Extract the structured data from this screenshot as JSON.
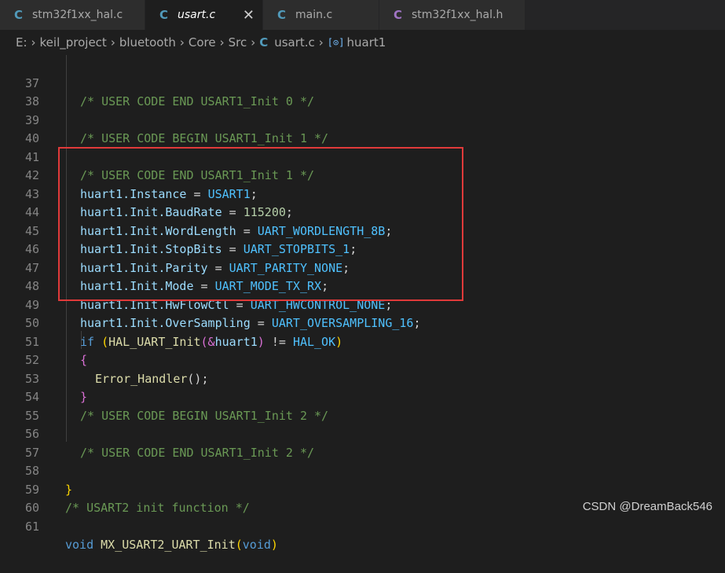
{
  "tabs": [
    {
      "icon": "C",
      "title": "stm32f1xx_hal.c"
    },
    {
      "icon": "C",
      "title": "usart.c",
      "close": "✕"
    },
    {
      "icon": "C",
      "title": "main.c"
    },
    {
      "icon": "C",
      "title": "stm32f1xx_hal.h"
    }
  ],
  "breadcrumb": {
    "items": [
      "E:",
      "keil_project",
      "bluetooth",
      "Core",
      "Src"
    ],
    "file_icon": "C",
    "file": "usart.c",
    "symbol_icon": "[⊙]",
    "symbol": "huart1",
    "separator": "›"
  },
  "code": {
    "l37": "37",
    "l38": "38",
    "l39": "39",
    "l40": "40",
    "l41": "41",
    "l42": "42",
    "l43": "43",
    "l44": "44",
    "l45": "45",
    "l46": "46",
    "l47": "47",
    "l48": "48",
    "l49": "49",
    "l50": "50",
    "l51": "51",
    "l52": "52",
    "l53": "53",
    "l54": "54",
    "l55": "55",
    "l56": "56",
    "l57": "57",
    "l58": "58",
    "l59": "59",
    "l60": "60",
    "l61": "61",
    "c37": "/* USER CODE END USART1_Init 0 */",
    "c39": "/* USER CODE BEGIN USART1_Init 1 */",
    "c41": "/* USER CODE END USART1_Init 1 */",
    "s42a": "huart1.Instance",
    "s42b": " = ",
    "s42c": "USART1",
    "s42d": ";",
    "s43a": "huart1.Init.BaudRate",
    "s43b": " = ",
    "s43c": "115200",
    "s43d": ";",
    "s44a": "huart1.Init.WordLength",
    "s44b": " = ",
    "s44c": "UART_WORDLENGTH_8B",
    "s44d": ";",
    "s45a": "huart1.Init.StopBits",
    "s45b": " = ",
    "s45c": "UART_STOPBITS_1",
    "s45d": ";",
    "s46a": "huart1.Init.Parity",
    "s46b": " = ",
    "s46c": "UART_PARITY_NONE",
    "s46d": ";",
    "s47a": "huart1.Init.Mode",
    "s47b": " = ",
    "s47c": "UART_MODE_TX_RX",
    "s47d": ";",
    "s48a": "huart1.Init.HwFlowCtl",
    "s48b": " = ",
    "s48c": "UART_HWCONTROL_NONE",
    "s48d": ";",
    "s49a": "huart1.Init.OverSampling",
    "s49b": " = ",
    "s49c": "UART_OVERSAMPLING_16",
    "s49d": ";",
    "s50a": "if",
    "s50b": " (",
    "s50c": "HAL_UART_Init",
    "s50d": "(&",
    "s50e": "huart1",
    "s50f": ")",
    " s50g": "",
    "s50h": " != ",
    "s50i": "HAL_OK",
    "s50j": ")",
    "s51": "{",
    "s52a": "Error_Handler",
    "s52b": "();",
    "s53": "}",
    "c54": "/* USER CODE BEGIN USART1_Init 2 */",
    "c56": "/* USER CODE END USART1_Init 2 */",
    "s58": "}",
    "c59": "/* USART2 init function */",
    "s61a": "void",
    "s61b": " ",
    "s61c": "MX_USART2_UART_Init",
    "s61d": "(",
    "s61e": "void",
    "s61f": ")"
  },
  "watermark": "CSDN @DreamBack546",
  "colors": {
    "highlight_box": "#e03a3a",
    "background": "#1e1e1e"
  }
}
